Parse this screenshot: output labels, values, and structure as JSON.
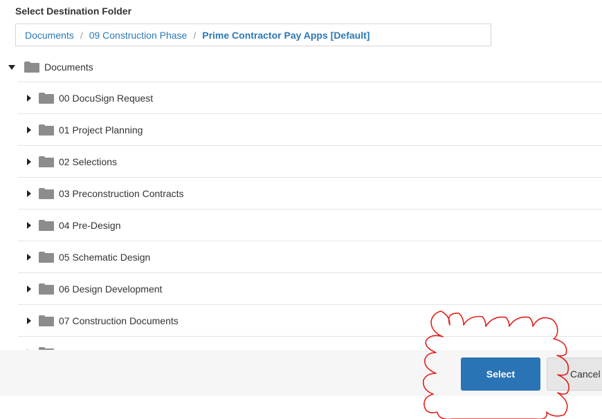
{
  "dialog": {
    "title": "Select Destination Folder"
  },
  "breadcrumb": {
    "items": [
      "Documents",
      "09 Construction Phase"
    ],
    "current": "Prime Contractor Pay Apps [Default]",
    "separator": "/"
  },
  "tree": {
    "root": {
      "label": "Documents",
      "expanded": true
    },
    "children": [
      {
        "label": "00 DocuSign Request"
      },
      {
        "label": "01 Project Planning"
      },
      {
        "label": "02 Selections"
      },
      {
        "label": "03 Preconstruction Contracts"
      },
      {
        "label": "04 Pre-Design"
      },
      {
        "label": "05 Schematic Design"
      },
      {
        "label": "06 Design Development"
      },
      {
        "label": "07 Construction Documents"
      }
    ]
  },
  "buttons": {
    "select_label": "Select",
    "cancel_label": "Cancel"
  },
  "colors": {
    "accent": "#2a73b4",
    "link": "#2a78b6",
    "annotation": "#e0201b",
    "folder": "#8c8c8c"
  }
}
